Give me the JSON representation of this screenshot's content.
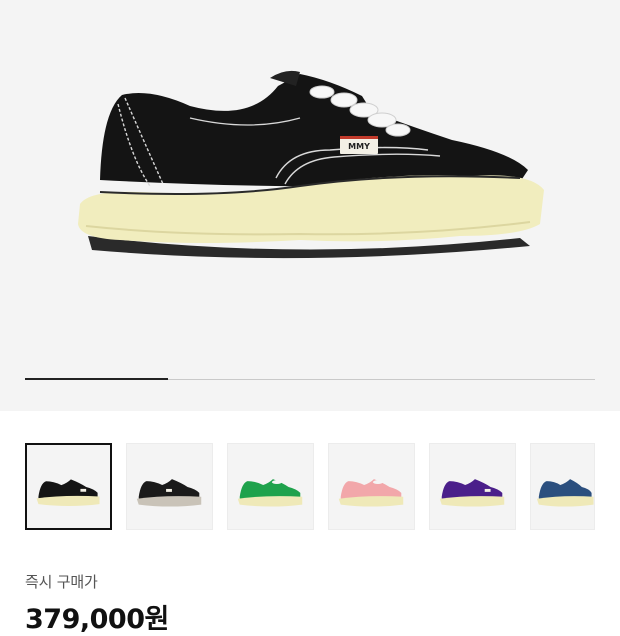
{
  "product": {
    "main_image": "black canvas low-top sneaker with cream melted sole",
    "logo_tag": "MMY",
    "gallery_progress": 0.25
  },
  "thumbnails": [
    {
      "name": "black",
      "upper": "#151515",
      "sole": "#efe9b8",
      "selected": true
    },
    {
      "name": "black-grey",
      "upper": "#1a1a1a",
      "sole": "#c9c3b8",
      "selected": false
    },
    {
      "name": "green",
      "upper": "#1fa24c",
      "sole": "#efe9b8",
      "selected": false
    },
    {
      "name": "pink",
      "upper": "#f2a7aa",
      "sole": "#efe9b8",
      "selected": false
    },
    {
      "name": "purple",
      "upper": "#4b1f8a",
      "sole": "#efe9b8",
      "selected": false
    },
    {
      "name": "navy",
      "upper": "#2b4f7e",
      "sole": "#efe9b8",
      "selected": false
    }
  ],
  "purchase": {
    "label": "즉시 구매가",
    "price": "379,000원"
  },
  "colors": {
    "background": "#f4f4f4",
    "price_text": "#111111"
  }
}
